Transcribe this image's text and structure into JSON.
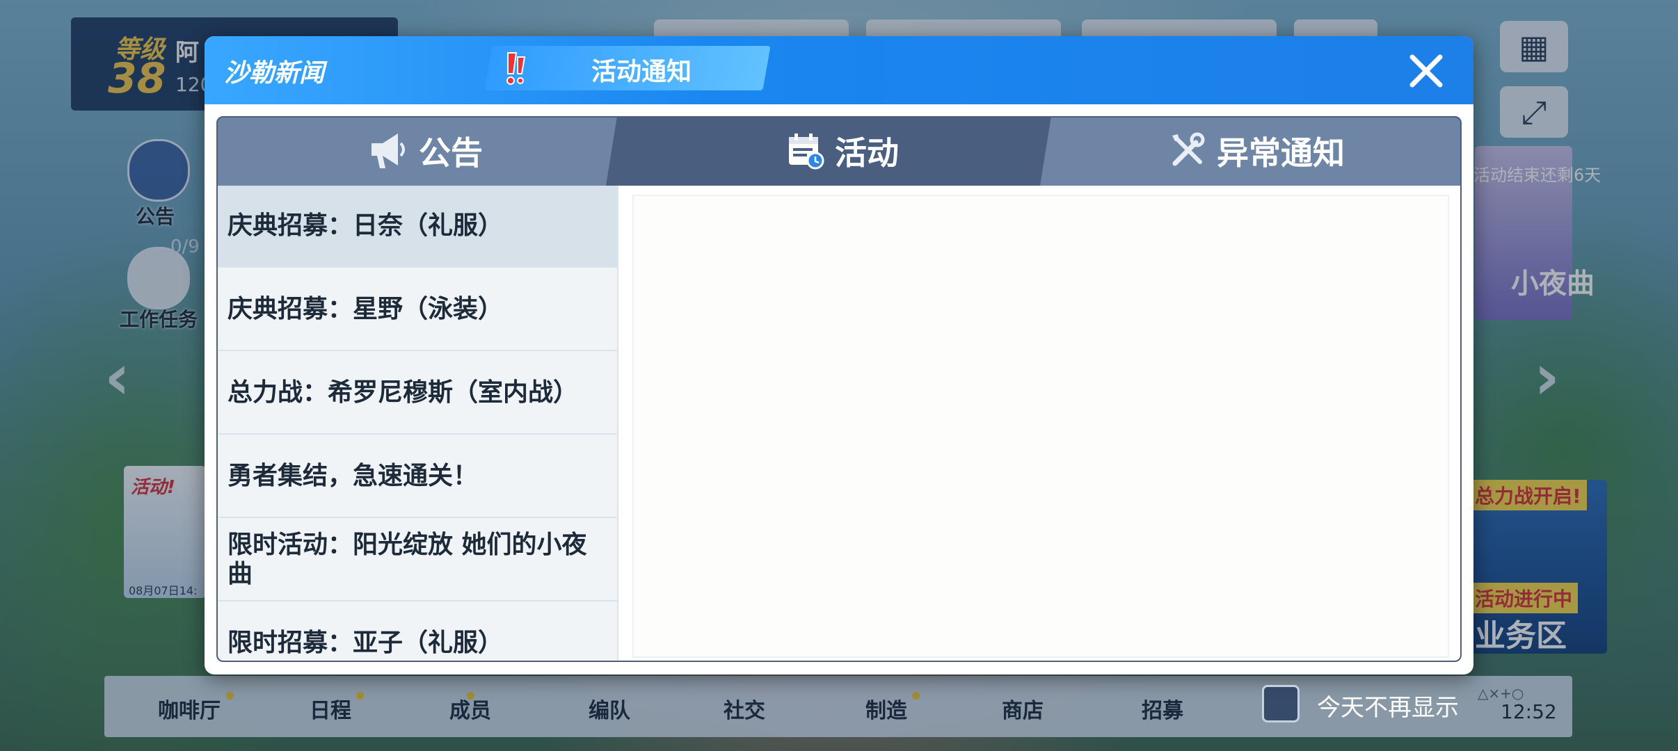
{
  "background": {
    "level_label": "等级",
    "level_value": "38",
    "player_name": "阿",
    "player_sub": "120",
    "side_announce_label": "公告",
    "side_task_label": "工作任务",
    "task_counter": "0/9",
    "event_badge": "活动!",
    "event_date": "08月07日14:",
    "right_countdown": "活动结束还剩6天",
    "right_banner_text": "小夜曲",
    "right_promo_title": "总力战开启!",
    "right_promo_status": "活动进行中",
    "right_promo_zone": "业务区",
    "taskbar_items": [
      "咖啡厅",
      "日程",
      "成员",
      "编队",
      "社交",
      "制造",
      "商店",
      "招募"
    ]
  },
  "dialog": {
    "title": "沙勒新闻",
    "header_tab": "活动通知",
    "tabs": [
      {
        "label": "公告",
        "icon": "megaphone-icon"
      },
      {
        "label": "活动",
        "icon": "calendar-icon"
      },
      {
        "label": "异常通知",
        "icon": "tools-icon"
      }
    ],
    "active_tab": "活动",
    "items": [
      "庆典招募：日奈（礼服）",
      "庆典招募：星野（泳装）",
      "总力战：希罗尼穆斯（室内战）",
      "勇者集结，急速通关！",
      "限时活动：阳光绽放 她们的小夜曲",
      "限时招募：亚子（礼服）"
    ],
    "selected_item": "庆典招募：日奈（礼服）"
  },
  "footer": {
    "dont_show_today": "今天不再显示",
    "clock": "12:52",
    "status_icons": "△×+○"
  },
  "colors": {
    "header_blue": "#1d7fe8",
    "tab_bar": "#6f85a5",
    "tab_active": "#4a5f80",
    "list_selected": "#d7e1ea"
  }
}
